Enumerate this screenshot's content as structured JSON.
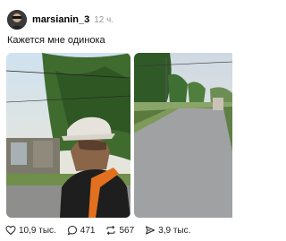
{
  "post": {
    "username": "marsianin_3",
    "time": "12 ч.",
    "caption": "Кажется мне одинока"
  },
  "actions": {
    "likes": "10,9 тыс.",
    "replies": "471",
    "reposts": "567",
    "shares": "3,9 тыс."
  },
  "icons": {
    "like": "heart-icon",
    "reply": "comment-icon",
    "repost": "repost-icon",
    "share": "send-icon"
  }
}
